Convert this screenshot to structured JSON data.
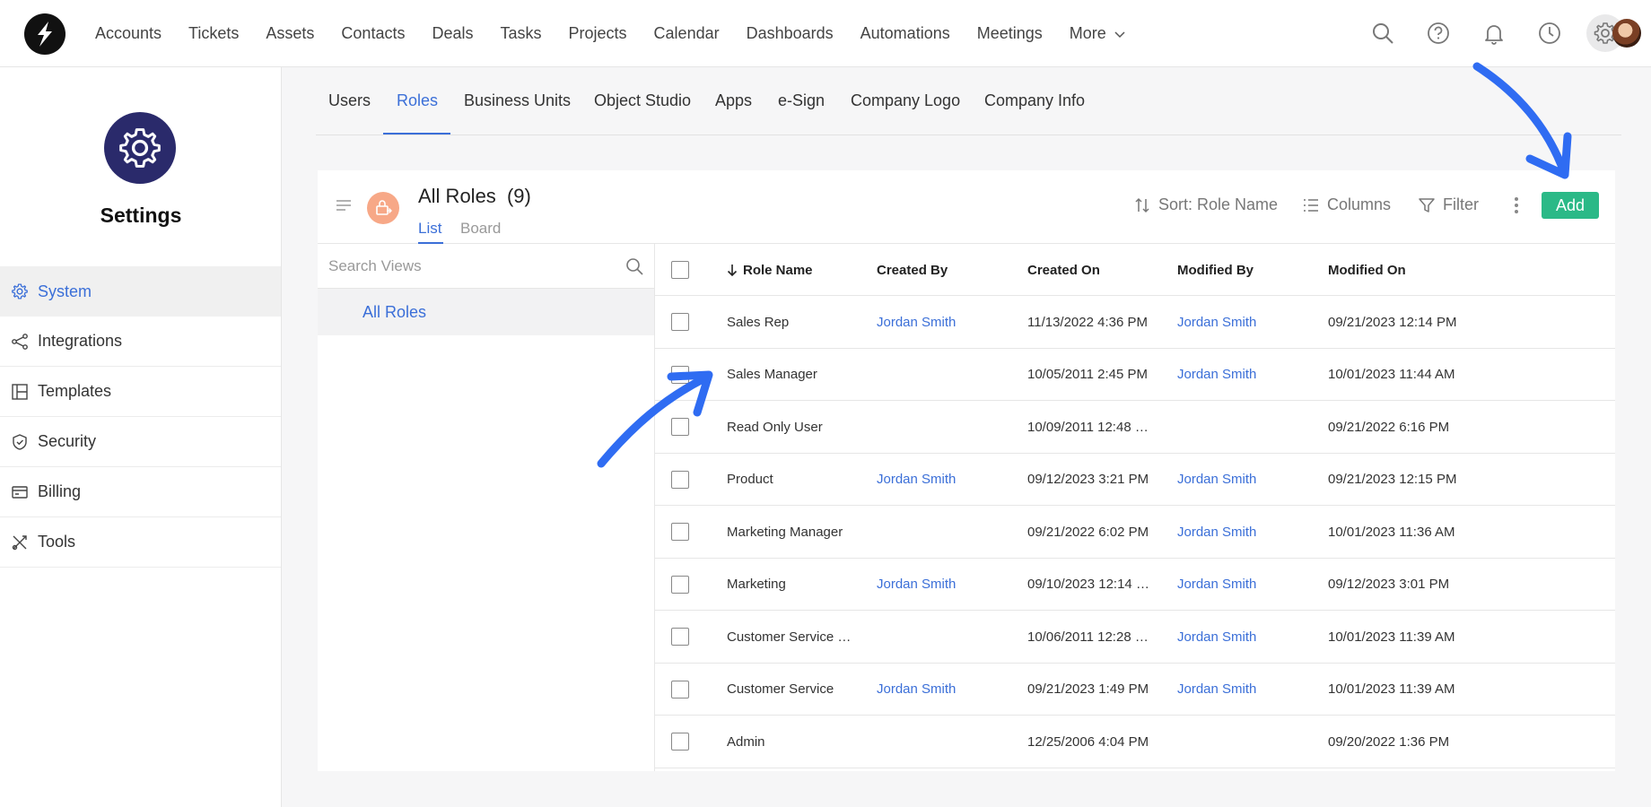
{
  "nav": {
    "items": [
      "Accounts",
      "Tickets",
      "Assets",
      "Contacts",
      "Deals",
      "Tasks",
      "Projects",
      "Calendar",
      "Dashboards",
      "Automations",
      "Meetings"
    ],
    "more_label": "More"
  },
  "top_icons": [
    "search-icon",
    "help-icon",
    "bell-icon",
    "clock-icon",
    "gear-icon"
  ],
  "sidebar": {
    "title": "Settings",
    "items": [
      {
        "label": "System",
        "icon": "gear-icon",
        "active": true
      },
      {
        "label": "Integrations",
        "icon": "share-icon"
      },
      {
        "label": "Templates",
        "icon": "template-icon"
      },
      {
        "label": "Security",
        "icon": "shield-icon"
      },
      {
        "label": "Billing",
        "icon": "card-icon"
      },
      {
        "label": "Tools",
        "icon": "tools-icon"
      }
    ]
  },
  "subtabs": {
    "items": [
      "Users",
      "Roles",
      "Business Units",
      "Object Studio",
      "Apps",
      "e-Sign",
      "Company Logo",
      "Company Info"
    ],
    "active": "Roles"
  },
  "view": {
    "title": "All Roles",
    "count": "(9)",
    "tabs": [
      "List",
      "Board"
    ],
    "sort_label": "Sort: Role Name",
    "columns_label": "Columns",
    "filter_label": "Filter",
    "add_label": "Add"
  },
  "views_panel": {
    "search_placeholder": "Search Views",
    "items": [
      "All Roles"
    ]
  },
  "table": {
    "columns": [
      "Role Name",
      "Created By",
      "Created On",
      "Modified By",
      "Modified On"
    ],
    "rows": [
      {
        "role": "Sales Rep",
        "created_by": "Jordan Smith",
        "created_on": "11/13/2022 4:36 PM",
        "modified_by": "Jordan Smith",
        "modified_on": "09/21/2023 12:14 PM"
      },
      {
        "role": "Sales Manager",
        "created_by": "",
        "created_on": "10/05/2011 2:45 PM",
        "modified_by": "Jordan Smith",
        "modified_on": "10/01/2023 11:44 AM"
      },
      {
        "role": "Read Only User",
        "created_by": "",
        "created_on": "10/09/2011 12:48 …",
        "modified_by": "",
        "modified_on": "09/21/2022 6:16 PM"
      },
      {
        "role": "Product",
        "created_by": "Jordan Smith",
        "created_on": "09/12/2023 3:21 PM",
        "modified_by": "Jordan Smith",
        "modified_on": "09/21/2023 12:15 PM"
      },
      {
        "role": "Marketing Manager",
        "created_by": "",
        "created_on": "09/21/2022 6:02 PM",
        "modified_by": "Jordan Smith",
        "modified_on": "10/01/2023 11:36 AM"
      },
      {
        "role": "Marketing",
        "created_by": "Jordan Smith",
        "created_on": "09/10/2023 12:14 …",
        "modified_by": "Jordan Smith",
        "modified_on": "09/12/2023 3:01 PM"
      },
      {
        "role": "Customer Service …",
        "created_by": "",
        "created_on": "10/06/2011 12:28 …",
        "modified_by": "Jordan Smith",
        "modified_on": "10/01/2023 11:39 AM"
      },
      {
        "role": "Customer Service",
        "created_by": "Jordan Smith",
        "created_on": "09/21/2023 1:49 PM",
        "modified_by": "Jordan Smith",
        "modified_on": "10/01/2023 11:39 AM"
      },
      {
        "role": "Admin",
        "created_by": "",
        "created_on": "12/25/2006 4:04 PM",
        "modified_by": "",
        "modified_on": "09/20/2022 1:36 PM"
      }
    ]
  },
  "colors": {
    "accent_blue": "#3b6fd8",
    "add_green": "#2bb987",
    "settings_badge": "#2a2a6b",
    "role_icon": "#f7a887",
    "annotation_arrow": "#2f6cf2"
  }
}
